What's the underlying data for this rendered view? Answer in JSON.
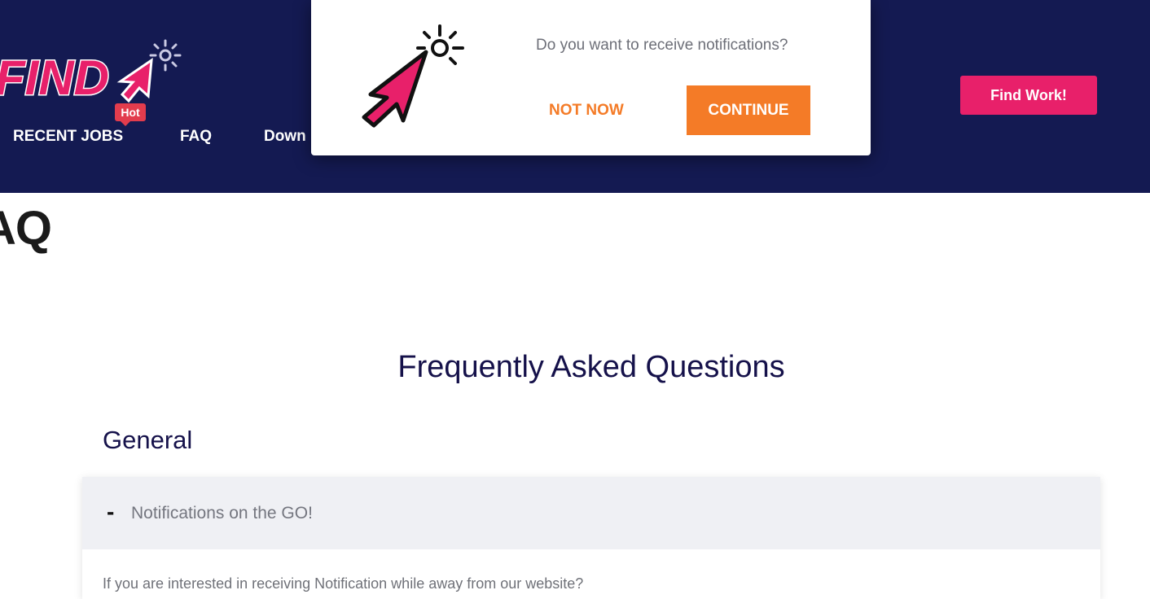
{
  "header": {
    "logo_text": "FIND",
    "hot_badge": "Hot",
    "nav": [
      {
        "label": "RECENT JOBS"
      },
      {
        "label": "FAQ"
      },
      {
        "label": "Down"
      }
    ],
    "find_work_label": "Find Work!"
  },
  "page": {
    "title": "AQ",
    "faq_heading": "Frequently Asked Questions",
    "section": "General"
  },
  "accordion": {
    "toggle": "-",
    "title": "Notifications on the GO!",
    "body": "If you are interested in receiving Notification while away from our website?"
  },
  "popup": {
    "message": "Do you want to receive notifications?",
    "not_now_label": "NOT NOW",
    "continue_label": "CONTINUE"
  },
  "colors": {
    "header_bg": "#141a52",
    "brand_pink": "#e8206a",
    "accent_orange": "#f47b27",
    "heading_navy": "#15114a"
  }
}
